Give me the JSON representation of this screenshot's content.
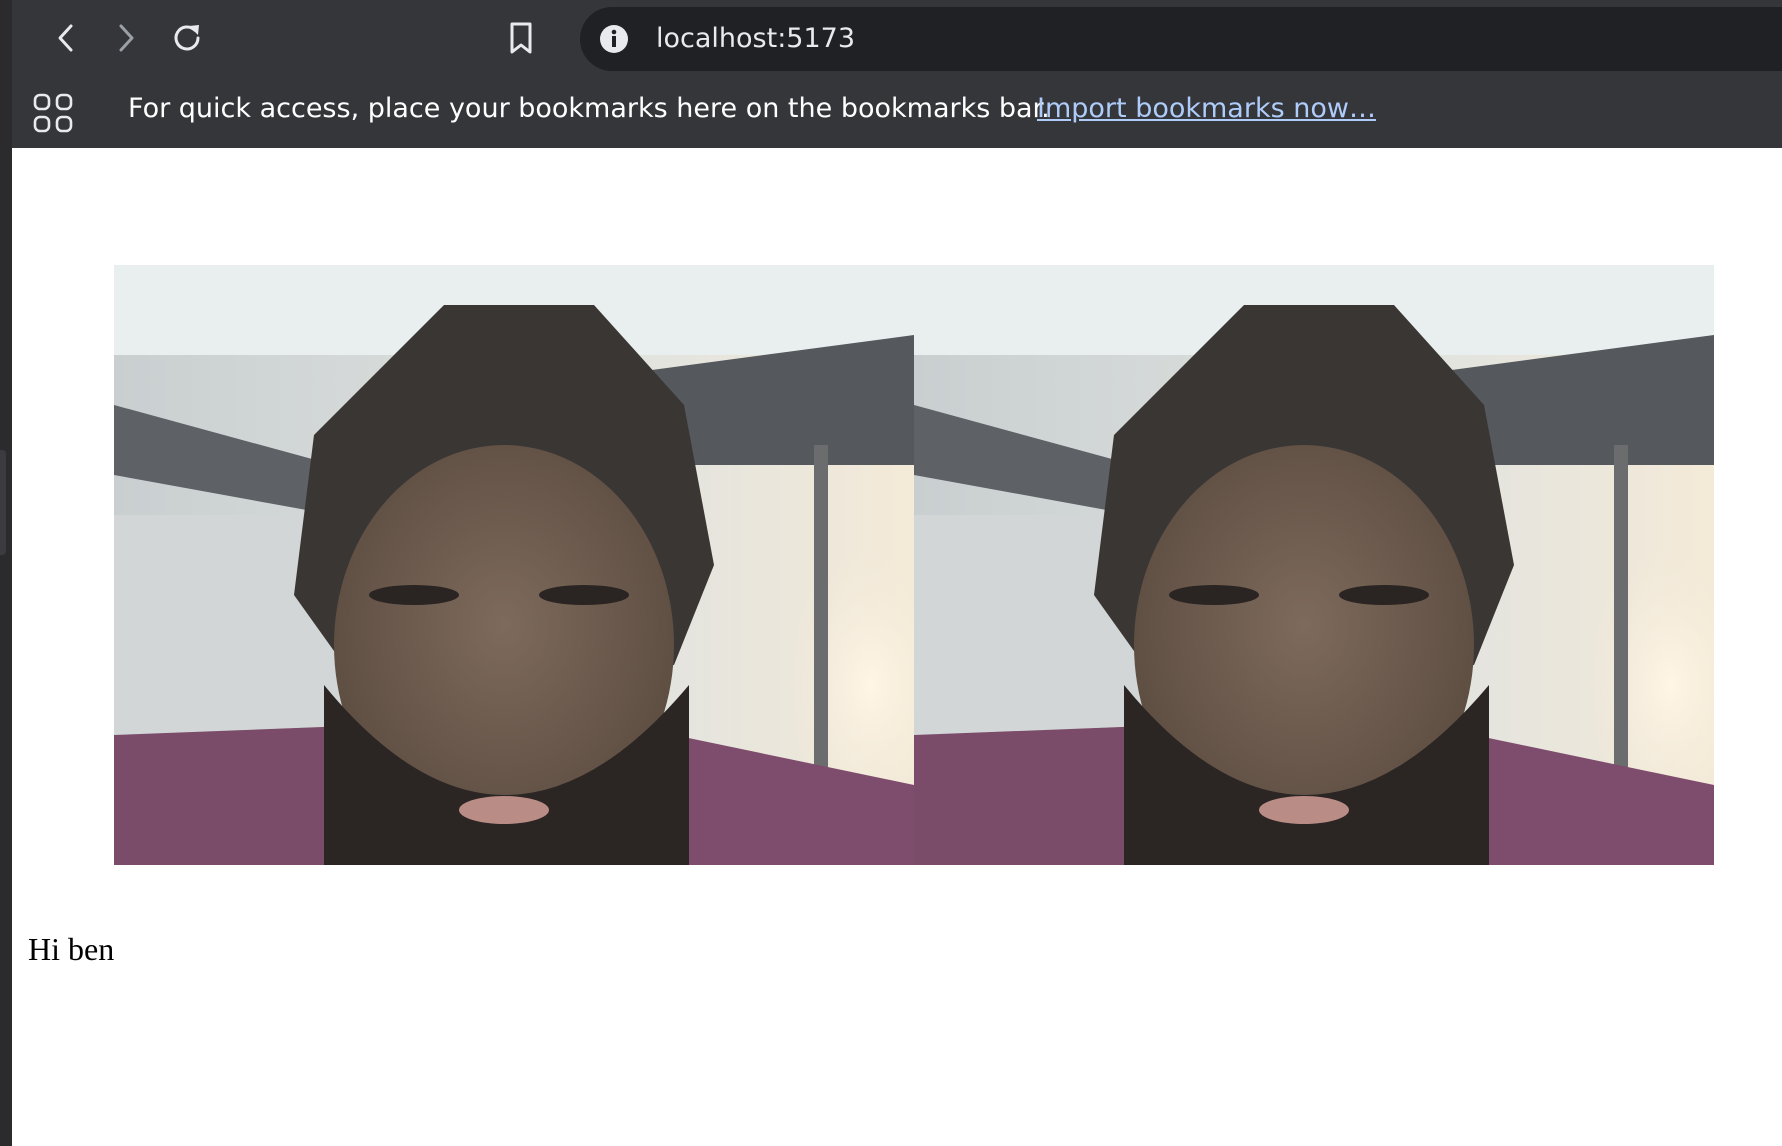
{
  "browser": {
    "url": "localhost:5173",
    "bookmarks_bar": {
      "message": "For quick access, place your bookmarks here on the bookmarks bar.",
      "import_link": "Import bookmarks now…"
    }
  },
  "toolbar_icons": [
    "back-icon",
    "forward-icon",
    "reload-icon",
    "bookmark-icon",
    "info-icon",
    "apps-icon"
  ],
  "page": {
    "videos": [
      {
        "description": "local-video-feed"
      },
      {
        "description": "remote-video-feed"
      }
    ],
    "message": "Hi ben"
  }
}
